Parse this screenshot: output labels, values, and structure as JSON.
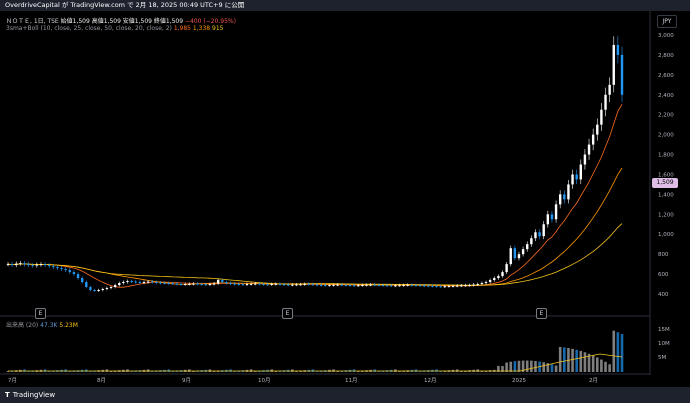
{
  "header": {
    "publish_text": "OverdriveCapital が TradingView.com で 2月 18, 2025 00:49 UTC+9 に公開"
  },
  "legend": {
    "symbol": "ＮＯＴＥ, 1日, TSE",
    "ohlc": "始値1,509 高値1,509 安値1,509 終値1,509",
    "change": "−400 (−20.95%)",
    "indicator": "3sma+Boll (10, close, 25, close, 50, close, 20, close, 2)",
    "ind_v1": "1,985",
    "ind_v2": "1,338",
    "ind_v3": "915",
    "volume_name": "出来高 (20)",
    "volume_v1": "47.3K",
    "volume_v2": "5.23M"
  },
  "currency": "JPY",
  "last_price": "1,509",
  "earnings_marker": "E",
  "price_axis": [
    "3,000",
    "2,800",
    "2,600",
    "2,400",
    "2,200",
    "2,000",
    "1,800",
    "1,600",
    "1,400",
    "1,200",
    "1,000",
    "800",
    "600",
    "400"
  ],
  "volume_axis": [
    "15M",
    "10M",
    "5M"
  ],
  "time_axis": [
    "7月",
    "8月",
    "9月",
    "10月",
    "11月",
    "12月",
    "2025",
    "2月"
  ],
  "footer": {
    "brand": "TradingView"
  },
  "colors": {
    "sma10": "#ff6d1f",
    "sma25": "#ff9800",
    "sma50": "#f5c518",
    "up": "#ffffff",
    "down": "#2196f3",
    "price_label": "#e1bee7"
  },
  "chart_data": {
    "type": "candlestick",
    "ylim": [
      300,
      3100
    ],
    "price_series_approx": {
      "x": [
        "7月",
        "8月",
        "9月",
        "10月",
        "11月",
        "12月",
        "2025",
        "2月"
      ],
      "close": [
        680,
        440,
        520,
        500,
        490,
        480,
        560,
        2800
      ]
    },
    "last": 1509
  }
}
